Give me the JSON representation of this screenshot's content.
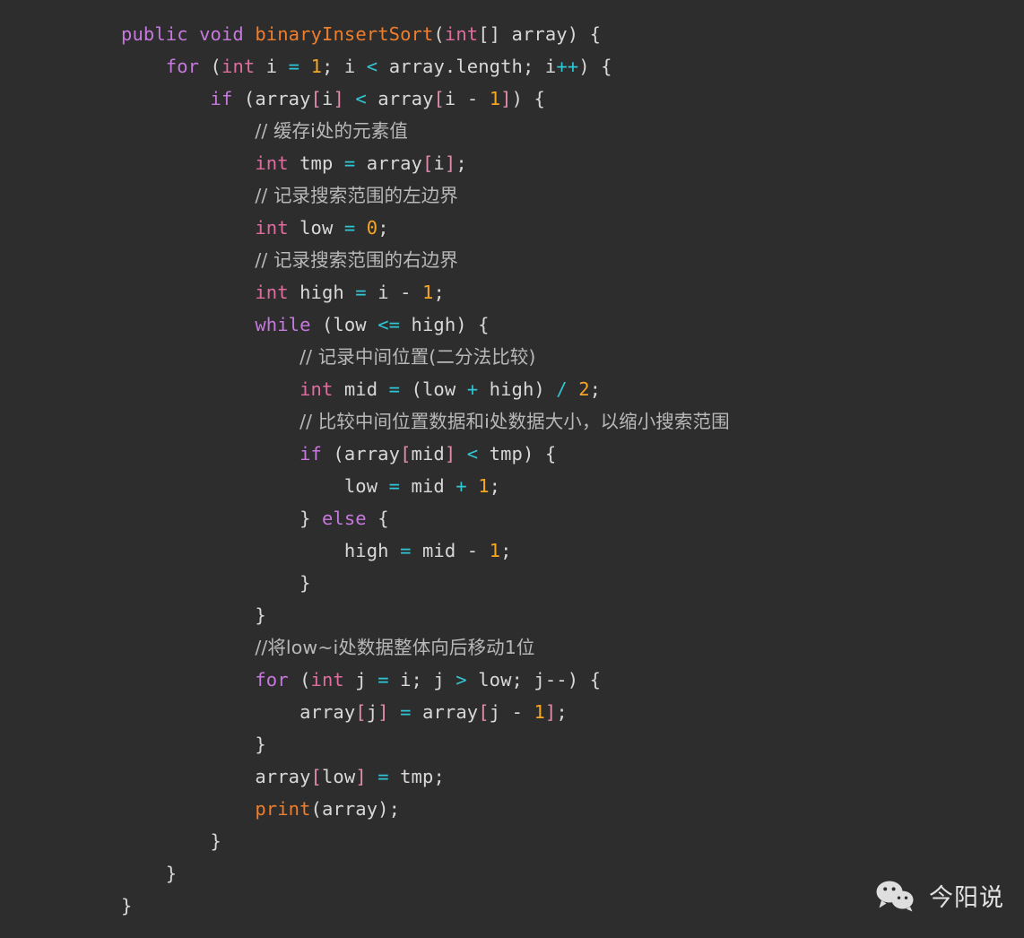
{
  "editor": {
    "background_color": "#2d2d2d",
    "language": "java",
    "font_size_px": 20.5,
    "line_height_px": 36
  },
  "theme": {
    "keyword_color": "#c678dd",
    "type_color": "#e06c9f",
    "method_color": "#f07d2b",
    "number_color": "#f5a623",
    "operator_color": "#2fc7d6",
    "plain_color": "#d8d8d8",
    "bracket_color": "#e08cae",
    "comment_color": "#b8b8b8"
  },
  "code": {
    "lines": [
      {
        "indent": 0,
        "tokens": [
          {
            "t": "public",
            "c": "keyword"
          },
          {
            "t": " ",
            "c": "plain"
          },
          {
            "t": "void",
            "c": "keyword"
          },
          {
            "t": " ",
            "c": "plain"
          },
          {
            "t": "binaryInsertSort",
            "c": "method"
          },
          {
            "t": "(",
            "c": "punct"
          },
          {
            "t": "int",
            "c": "type"
          },
          {
            "t": "[] ",
            "c": "plain"
          },
          {
            "t": "array",
            "c": "plain"
          },
          {
            "t": ") {",
            "c": "punct"
          }
        ]
      },
      {
        "indent": 1,
        "tokens": [
          {
            "t": "for",
            "c": "keyword"
          },
          {
            "t": " (",
            "c": "punct"
          },
          {
            "t": "int",
            "c": "type"
          },
          {
            "t": " i ",
            "c": "plain"
          },
          {
            "t": "=",
            "c": "operator"
          },
          {
            "t": " ",
            "c": "plain"
          },
          {
            "t": "1",
            "c": "number"
          },
          {
            "t": "; i ",
            "c": "plain"
          },
          {
            "t": "<",
            "c": "operator"
          },
          {
            "t": " array.length; i",
            "c": "plain"
          },
          {
            "t": "++",
            "c": "operator"
          },
          {
            "t": ") {",
            "c": "punct"
          }
        ]
      },
      {
        "indent": 2,
        "tokens": [
          {
            "t": "if",
            "c": "keyword"
          },
          {
            "t": " (array",
            "c": "plain"
          },
          {
            "t": "[",
            "c": "bracket"
          },
          {
            "t": "i",
            "c": "plain"
          },
          {
            "t": "]",
            "c": "bracket"
          },
          {
            "t": " ",
            "c": "plain"
          },
          {
            "t": "<",
            "c": "operator"
          },
          {
            "t": " array",
            "c": "plain"
          },
          {
            "t": "[",
            "c": "bracket"
          },
          {
            "t": "i ",
            "c": "plain"
          },
          {
            "t": "-",
            "c": "plain"
          },
          {
            "t": " ",
            "c": "plain"
          },
          {
            "t": "1",
            "c": "number"
          },
          {
            "t": "]",
            "c": "bracket"
          },
          {
            "t": ") {",
            "c": "punct"
          }
        ]
      },
      {
        "indent": 3,
        "tokens": [
          {
            "t": "// 缓存i处的元素值",
            "c": "comment"
          }
        ]
      },
      {
        "indent": 3,
        "tokens": [
          {
            "t": "int",
            "c": "type"
          },
          {
            "t": " tmp ",
            "c": "plain"
          },
          {
            "t": "=",
            "c": "operator"
          },
          {
            "t": " array",
            "c": "plain"
          },
          {
            "t": "[",
            "c": "bracket"
          },
          {
            "t": "i",
            "c": "plain"
          },
          {
            "t": "]",
            "c": "bracket"
          },
          {
            "t": ";",
            "c": "punct"
          }
        ]
      },
      {
        "indent": 3,
        "tokens": [
          {
            "t": "// 记录搜索范围的左边界",
            "c": "comment"
          }
        ]
      },
      {
        "indent": 3,
        "tokens": [
          {
            "t": "int",
            "c": "type"
          },
          {
            "t": " low ",
            "c": "plain"
          },
          {
            "t": "=",
            "c": "operator"
          },
          {
            "t": " ",
            "c": "plain"
          },
          {
            "t": "0",
            "c": "number"
          },
          {
            "t": ";",
            "c": "punct"
          }
        ]
      },
      {
        "indent": 3,
        "tokens": [
          {
            "t": "// 记录搜索范围的右边界",
            "c": "comment"
          }
        ]
      },
      {
        "indent": 3,
        "tokens": [
          {
            "t": "int",
            "c": "type"
          },
          {
            "t": " high ",
            "c": "plain"
          },
          {
            "t": "=",
            "c": "operator"
          },
          {
            "t": " i ",
            "c": "plain"
          },
          {
            "t": "-",
            "c": "plain"
          },
          {
            "t": " ",
            "c": "plain"
          },
          {
            "t": "1",
            "c": "number"
          },
          {
            "t": ";",
            "c": "punct"
          }
        ]
      },
      {
        "indent": 3,
        "tokens": [
          {
            "t": "while",
            "c": "keyword"
          },
          {
            "t": " (low ",
            "c": "plain"
          },
          {
            "t": "<=",
            "c": "operator"
          },
          {
            "t": " high) {",
            "c": "plain"
          }
        ]
      },
      {
        "indent": 4,
        "tokens": [
          {
            "t": "// 记录中间位置(二分法比较)",
            "c": "comment"
          }
        ]
      },
      {
        "indent": 4,
        "tokens": [
          {
            "t": "int",
            "c": "type"
          },
          {
            "t": " mid ",
            "c": "plain"
          },
          {
            "t": "=",
            "c": "operator"
          },
          {
            "t": " (low ",
            "c": "plain"
          },
          {
            "t": "+",
            "c": "operator"
          },
          {
            "t": " high) ",
            "c": "plain"
          },
          {
            "t": "/",
            "c": "operator"
          },
          {
            "t": " ",
            "c": "plain"
          },
          {
            "t": "2",
            "c": "number"
          },
          {
            "t": ";",
            "c": "punct"
          }
        ]
      },
      {
        "indent": 4,
        "tokens": [
          {
            "t": "// 比较中间位置数据和i处数据大小，以缩小搜索范围",
            "c": "comment"
          }
        ]
      },
      {
        "indent": 4,
        "tokens": [
          {
            "t": "if",
            "c": "keyword"
          },
          {
            "t": " (array",
            "c": "plain"
          },
          {
            "t": "[",
            "c": "bracket"
          },
          {
            "t": "mid",
            "c": "plain"
          },
          {
            "t": "]",
            "c": "bracket"
          },
          {
            "t": " ",
            "c": "plain"
          },
          {
            "t": "<",
            "c": "operator"
          },
          {
            "t": " tmp) {",
            "c": "plain"
          }
        ]
      },
      {
        "indent": 5,
        "tokens": [
          {
            "t": "low ",
            "c": "plain"
          },
          {
            "t": "=",
            "c": "operator"
          },
          {
            "t": " mid ",
            "c": "plain"
          },
          {
            "t": "+",
            "c": "operator"
          },
          {
            "t": " ",
            "c": "plain"
          },
          {
            "t": "1",
            "c": "number"
          },
          {
            "t": ";",
            "c": "punct"
          }
        ]
      },
      {
        "indent": 4,
        "tokens": [
          {
            "t": "} ",
            "c": "punct"
          },
          {
            "t": "else",
            "c": "keyword"
          },
          {
            "t": " {",
            "c": "punct"
          }
        ]
      },
      {
        "indent": 5,
        "tokens": [
          {
            "t": "high ",
            "c": "plain"
          },
          {
            "t": "=",
            "c": "operator"
          },
          {
            "t": " mid ",
            "c": "plain"
          },
          {
            "t": "-",
            "c": "plain"
          },
          {
            "t": " ",
            "c": "plain"
          },
          {
            "t": "1",
            "c": "number"
          },
          {
            "t": ";",
            "c": "punct"
          }
        ]
      },
      {
        "indent": 4,
        "tokens": [
          {
            "t": "}",
            "c": "punct"
          }
        ]
      },
      {
        "indent": 3,
        "tokens": [
          {
            "t": "}",
            "c": "punct"
          }
        ]
      },
      {
        "indent": 3,
        "tokens": [
          {
            "t": "//将low~i处数据整体向后移动1位",
            "c": "comment"
          }
        ]
      },
      {
        "indent": 3,
        "tokens": [
          {
            "t": "for",
            "c": "keyword"
          },
          {
            "t": " (",
            "c": "punct"
          },
          {
            "t": "int",
            "c": "type"
          },
          {
            "t": " j ",
            "c": "plain"
          },
          {
            "t": "=",
            "c": "operator"
          },
          {
            "t": " i; j ",
            "c": "plain"
          },
          {
            "t": ">",
            "c": "operator"
          },
          {
            "t": " low; j",
            "c": "plain"
          },
          {
            "t": "--",
            "c": "plain"
          },
          {
            "t": ") {",
            "c": "punct"
          }
        ]
      },
      {
        "indent": 4,
        "tokens": [
          {
            "t": "array",
            "c": "plain"
          },
          {
            "t": "[",
            "c": "bracket"
          },
          {
            "t": "j",
            "c": "plain"
          },
          {
            "t": "]",
            "c": "bracket"
          },
          {
            "t": " ",
            "c": "plain"
          },
          {
            "t": "=",
            "c": "operator"
          },
          {
            "t": " array",
            "c": "plain"
          },
          {
            "t": "[",
            "c": "bracket"
          },
          {
            "t": "j ",
            "c": "plain"
          },
          {
            "t": "-",
            "c": "plain"
          },
          {
            "t": " ",
            "c": "plain"
          },
          {
            "t": "1",
            "c": "number"
          },
          {
            "t": "]",
            "c": "bracket"
          },
          {
            "t": ";",
            "c": "punct"
          }
        ]
      },
      {
        "indent": 3,
        "tokens": [
          {
            "t": "}",
            "c": "punct"
          }
        ]
      },
      {
        "indent": 3,
        "tokens": [
          {
            "t": "array",
            "c": "plain"
          },
          {
            "t": "[",
            "c": "bracket"
          },
          {
            "t": "low",
            "c": "plain"
          },
          {
            "t": "]",
            "c": "bracket"
          },
          {
            "t": " ",
            "c": "plain"
          },
          {
            "t": "=",
            "c": "operator"
          },
          {
            "t": " tmp;",
            "c": "plain"
          }
        ]
      },
      {
        "indent": 3,
        "tokens": [
          {
            "t": "print",
            "c": "func"
          },
          {
            "t": "(array);",
            "c": "plain"
          }
        ]
      },
      {
        "indent": 2,
        "tokens": [
          {
            "t": "}",
            "c": "punct"
          }
        ]
      },
      {
        "indent": 1,
        "tokens": [
          {
            "t": "}",
            "c": "punct"
          }
        ]
      },
      {
        "indent": 0,
        "tokens": [
          {
            "t": "}",
            "c": "punct"
          }
        ]
      }
    ]
  },
  "watermark": {
    "icon": "wechat-icon",
    "label": "今阳说"
  }
}
